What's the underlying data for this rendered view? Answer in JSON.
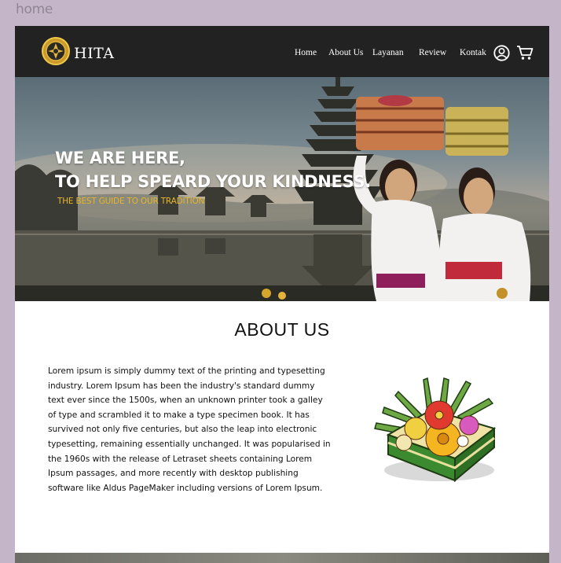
{
  "frame_label": "home",
  "nav": {
    "brand": "HITA",
    "links": [
      "Home",
      "About Us",
      "Layanan",
      "Review",
      "Kontak"
    ]
  },
  "hero": {
    "line1": "WE ARE HERE,",
    "line2": "TO HELP SPEARD YOUR KINDNESS.",
    "subtitle": "THE BEST GUIDE TO OUR TRADITION"
  },
  "about": {
    "title": "ABOUT US",
    "body": "Lorem ipsum is simply dummy text of the printing and typesetting industry. Lorem Ipsum has been the industry's standard dummy text ever since the 1500s, when an unknown printer took a galley of type and scrambled it to make a type specimen book. It has survived not only five centuries, but also the leap into electronic typesetting, remaining essentially unchanged. It was popularised in the 1960s with the release of Letraset sheets containing Lorem Ipsum passages, and more recently with desktop publishing software like Aldus PageMaker including versions of Lorem Ipsum."
  },
  "icons": {
    "logo": "hita-emblem-icon",
    "account": "user-circle-icon",
    "cart": "shopping-cart-icon",
    "canang": "canang-sari-offering-icon"
  },
  "colors": {
    "nav_bg": "#222222",
    "accent": "#e7b62a",
    "frame_bg": "#c5b5c9"
  }
}
